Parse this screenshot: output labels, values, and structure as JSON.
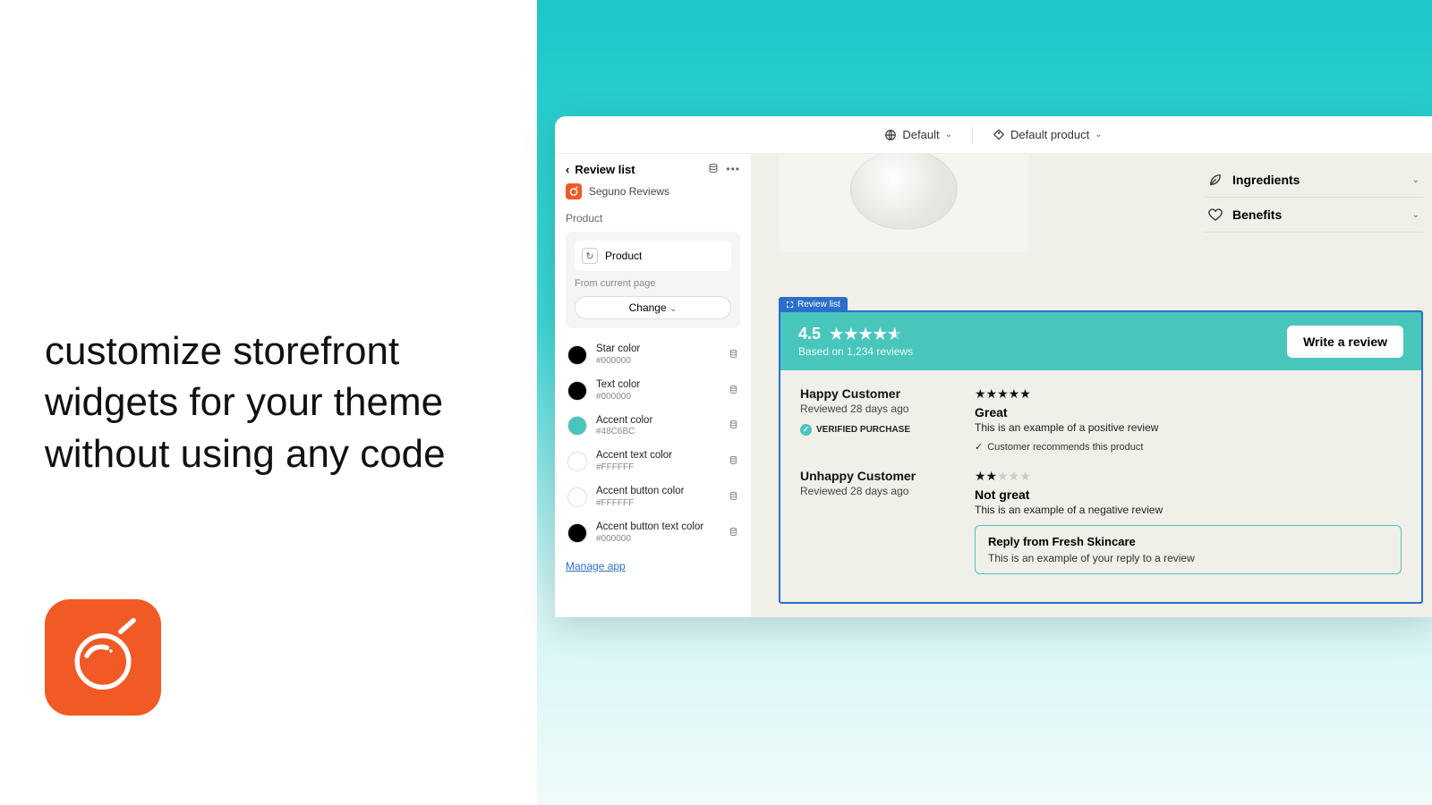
{
  "headline": "customize storefront widgets for your theme without using any code",
  "topbar": {
    "theme_label": "Default",
    "product_label": "Default product"
  },
  "sidebar": {
    "title": "Review list",
    "app_name": "Seguno Reviews",
    "section_label": "Product",
    "product_type": "Product",
    "from_text": "From current page",
    "change_label": "Change",
    "colors": [
      {
        "name": "Star color",
        "hex": "#000000",
        "swatch": "#000000"
      },
      {
        "name": "Text color",
        "hex": "#000000",
        "swatch": "#000000"
      },
      {
        "name": "Accent color",
        "hex": "#48C6BC",
        "swatch": "#48C6BC"
      },
      {
        "name": "Accent text color",
        "hex": "#FFFFFF",
        "swatch": "#FFFFFF"
      },
      {
        "name": "Accent button color",
        "hex": "#FFFFFF",
        "swatch": "#FFFFFF"
      },
      {
        "name": "Accent button text color",
        "hex": "#000000",
        "swatch": "#000000"
      }
    ],
    "manage_link": "Manage app"
  },
  "accordion": {
    "ingredients": "Ingredients",
    "benefits": "Benefits"
  },
  "widget": {
    "tag": "Review list",
    "rating": "4.5",
    "based_on": "Based on 1,234 reviews",
    "write_review": "Write a review",
    "reviews": [
      {
        "name": "Happy Customer",
        "date": "Reviewed 28 days ago",
        "verified": "VERIFIED PURCHASE",
        "stars": 5,
        "title": "Great",
        "body": "This is an example of a positive review",
        "recommend": "Customer recommends this product"
      },
      {
        "name": "Unhappy Customer",
        "date": "Reviewed 28 days ago",
        "stars": 2,
        "title": "Not great",
        "body": "This is an example of a negative review",
        "reply_from": "Reply from Fresh Skincare",
        "reply_body": "This is an example of your reply to a review"
      }
    ]
  }
}
